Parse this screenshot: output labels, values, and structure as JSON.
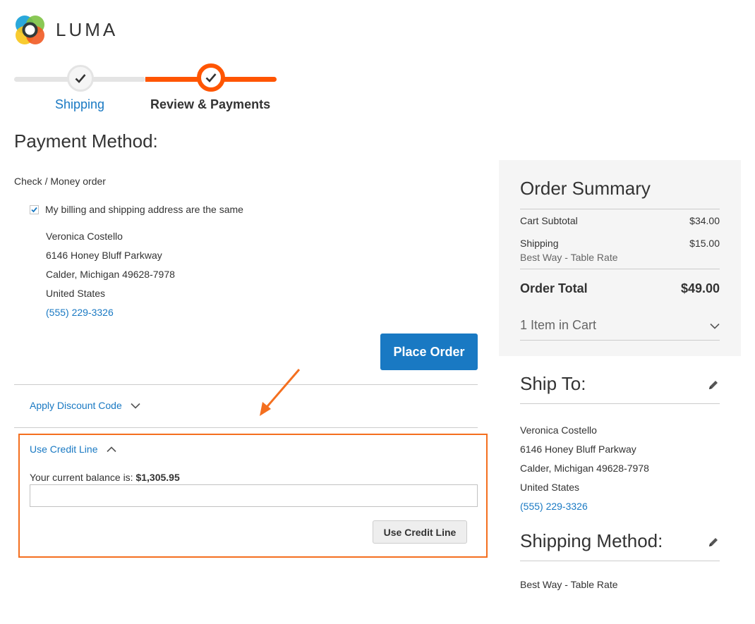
{
  "brand": {
    "name": "LUMA"
  },
  "progress": {
    "steps": [
      {
        "label": "Shipping",
        "state": "complete"
      },
      {
        "label": "Review & Payments",
        "state": "active"
      }
    ]
  },
  "payment": {
    "title": "Payment Method:",
    "method_name": "Check / Money order",
    "same_address_label": "My billing and shipping address are the same",
    "same_address_checked": true,
    "address": {
      "name": "Veronica Costello",
      "street": "6146 Honey Bluff Parkway",
      "city": "Calder, Michigan 49628-7978",
      "country": "United States",
      "phone": "(555) 229-3326"
    },
    "place_order_label": "Place Order"
  },
  "discount": {
    "label": "Apply Discount Code"
  },
  "credit_line": {
    "title": "Use Credit Line",
    "balance_label": "Your current balance is:",
    "balance_value": "$1,305.95",
    "input_value": "",
    "button_label": "Use Credit Line"
  },
  "summary": {
    "title": "Order Summary",
    "subtotal_label": "Cart Subtotal",
    "subtotal_value": "$34.00",
    "shipping_label": "Shipping",
    "shipping_value": "$15.00",
    "shipping_method": "Best Way - Table Rate",
    "total_label": "Order Total",
    "total_value": "$49.00",
    "items_label": "1 Item in Cart"
  },
  "ship_to": {
    "title": "Ship To:",
    "name": "Veronica Costello",
    "street": "6146 Honey Bluff Parkway",
    "city": "Calder, Michigan 49628-7978",
    "country": "United States",
    "phone": "(555) 229-3326"
  },
  "shipping_method": {
    "title": "Shipping Method:",
    "value": "Best Way - Table Rate"
  },
  "colors": {
    "accent": "#1979c3",
    "progress": "#ff5501",
    "highlight": "#f46f1f"
  }
}
